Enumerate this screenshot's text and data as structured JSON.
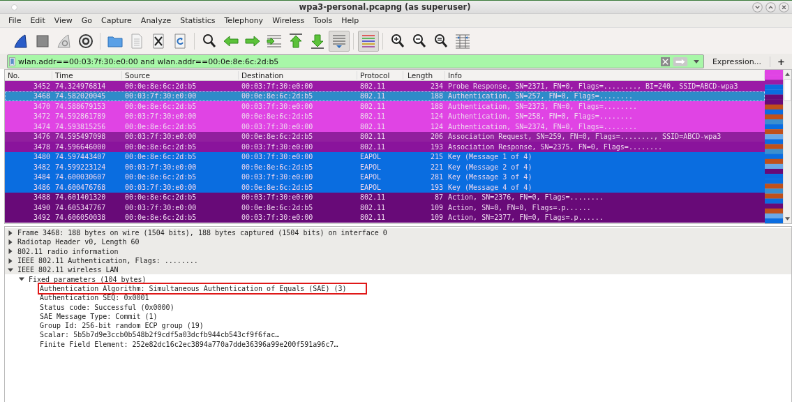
{
  "window": {
    "title": "wpa3-personal.pcapng (as superuser)"
  },
  "menu": [
    "File",
    "Edit",
    "View",
    "Go",
    "Capture",
    "Analyze",
    "Statistics",
    "Telephony",
    "Wireless",
    "Tools",
    "Help"
  ],
  "toolbar": [
    {
      "kind": "start",
      "pressed": false
    },
    {
      "kind": "stop",
      "pressed": false
    },
    {
      "kind": "restart",
      "pressed": false
    },
    {
      "kind": "options",
      "pressed": false
    },
    {
      "kind": "separator"
    },
    {
      "kind": "open",
      "pressed": false
    },
    {
      "kind": "save",
      "pressed": false
    },
    {
      "kind": "close",
      "pressed": false
    },
    {
      "kind": "reload",
      "pressed": false
    },
    {
      "kind": "separator"
    },
    {
      "kind": "find",
      "pressed": false
    },
    {
      "kind": "back",
      "pressed": false
    },
    {
      "kind": "forward",
      "pressed": false
    },
    {
      "kind": "goto",
      "pressed": false
    },
    {
      "kind": "first",
      "pressed": false
    },
    {
      "kind": "last",
      "pressed": false
    },
    {
      "kind": "autoscroll",
      "pressed": true
    },
    {
      "kind": "separator"
    },
    {
      "kind": "colorize",
      "pressed": true
    },
    {
      "kind": "separator"
    },
    {
      "kind": "zoomin",
      "pressed": false
    },
    {
      "kind": "zoomout",
      "pressed": false
    },
    {
      "kind": "zoomreset",
      "pressed": false
    },
    {
      "kind": "resize",
      "pressed": false
    }
  ],
  "filter": {
    "value": "wlan.addr==00:03:7f:30:e0:00 and wlan.addr==00:0e:8e:6c:2d:b5",
    "expression_button": "Expression...",
    "add_button": "+"
  },
  "table": {
    "columns": [
      "No.",
      "Time",
      "Source",
      "Destination",
      "Protocol",
      "Length",
      "Info"
    ],
    "rows": [
      {
        "no": "3452",
        "time": "74.324976814",
        "source": "00:0e:8e:6c:2d:b5",
        "destination": "00:03:7f:30:e0:00",
        "protocol": "802.11",
        "length": "234",
        "info": "Probe Response, SN=2371, FN=0, Flags=........, BI=240, SSID=ABCD-wpa3",
        "color": "#9a1aa6",
        "selected": false
      },
      {
        "no": "3468",
        "time": "74.582020045",
        "source": "00:03:7f:30:e0:00",
        "destination": "00:0e:8e:6c:2d:b5",
        "protocol": "802.11",
        "length": "188",
        "info": "Authentication, SN=257, FN=0, Flags=........",
        "color": "#2e8bc9",
        "selected": true
      },
      {
        "no": "3470",
        "time": "74.588679153",
        "source": "00:0e:8e:6c:2d:b5",
        "destination": "00:03:7f:30:e0:00",
        "protocol": "802.11",
        "length": "188",
        "info": "Authentication, SN=2373, FN=0, Flags=........",
        "color": "#e044e4",
        "selected": false
      },
      {
        "no": "3472",
        "time": "74.592861789",
        "source": "00:03:7f:30:e0:00",
        "destination": "00:0e:8e:6c:2d:b5",
        "protocol": "802.11",
        "length": "124",
        "info": "Authentication, SN=258, FN=0, Flags=........",
        "color": "#e044e4",
        "selected": false
      },
      {
        "no": "3474",
        "time": "74.593815256",
        "source": "00:0e:8e:6c:2d:b5",
        "destination": "00:03:7f:30:e0:00",
        "protocol": "802.11",
        "length": "124",
        "info": "Authentication, SN=2374, FN=0, Flags=........",
        "color": "#e044e4",
        "selected": false
      },
      {
        "no": "3476",
        "time": "74.595497098",
        "source": "00:03:7f:30:e0:00",
        "destination": "00:0e:8e:6c:2d:b5",
        "protocol": "802.11",
        "length": "206",
        "info": "Association Request, SN=259, FN=0, Flags=........, SSID=ABCD-wpa3",
        "color": "#911f9e",
        "selected": false
      },
      {
        "no": "3478",
        "time": "74.596646000",
        "source": "00:0e:8e:6c:2d:b5",
        "destination": "00:03:7f:30:e0:00",
        "protocol": "802.11",
        "length": "193",
        "info": "Association Response, SN=2375, FN=0, Flags=........",
        "color": "#8a149c",
        "selected": false
      },
      {
        "no": "3480",
        "time": "74.597443407",
        "source": "00:0e:8e:6c:2d:b5",
        "destination": "00:03:7f:30:e0:00",
        "protocol": "EAPOL",
        "length": "215",
        "info": "Key (Message 1 of 4)",
        "color": "#0a6de0",
        "selected": false
      },
      {
        "no": "3482",
        "time": "74.599223124",
        "source": "00:03:7f:30:e0:00",
        "destination": "00:0e:8e:6c:2d:b5",
        "protocol": "EAPOL",
        "length": "221",
        "info": "Key (Message 2 of 4)",
        "color": "#0a6de0",
        "selected": false
      },
      {
        "no": "3484",
        "time": "74.600030607",
        "source": "00:0e:8e:6c:2d:b5",
        "destination": "00:03:7f:30:e0:00",
        "protocol": "EAPOL",
        "length": "281",
        "info": "Key (Message 3 of 4)",
        "color": "#0a6de0",
        "selected": false
      },
      {
        "no": "3486",
        "time": "74.600476768",
        "source": "00:03:7f:30:e0:00",
        "destination": "00:0e:8e:6c:2d:b5",
        "protocol": "EAPOL",
        "length": "193",
        "info": "Key (Message 4 of 4)",
        "color": "#0a6de0",
        "selected": false
      },
      {
        "no": "3488",
        "time": "74.601401320",
        "source": "00:0e:8e:6c:2d:b5",
        "destination": "00:03:7f:30:e0:00",
        "protocol": "802.11",
        "length": "87",
        "info": "Action, SN=2376, FN=0, Flags=........",
        "color": "#680a78",
        "selected": false
      },
      {
        "no": "3490",
        "time": "74.605347767",
        "source": "00:03:7f:30:e0:00",
        "destination": "00:0e:8e:6c:2d:b5",
        "protocol": "802.11",
        "length": "109",
        "info": "Action, SN=0, FN=0, Flags=.p......",
        "color": "#680a78",
        "selected": false
      },
      {
        "no": "3492",
        "time": "74.606050038",
        "source": "00:0e:8e:6c:2d:b5",
        "destination": "00:03:7f:30:e0:00",
        "protocol": "802.11",
        "length": "109",
        "info": "Action, SN=2377, FN=0, Flags=.p......",
        "color": "#680a78",
        "selected": false
      }
    ]
  },
  "details": [
    {
      "text": "Frame 3468: 188 bytes on wire (1504 bits), 188 bytes captured (1504 bits) on interface 0",
      "expanded": false
    },
    {
      "text": "Radiotap Header v0, Length 60",
      "expanded": false
    },
    {
      "text": "802.11 radio information",
      "expanded": false
    },
    {
      "text": "IEEE 802.11 Authentication, Flags: ........",
      "expanded": false
    },
    {
      "text": "IEEE 802.11 wireless LAN",
      "expanded": true,
      "children": [
        {
          "text": "Fixed parameters (104 bytes)",
          "expanded": true,
          "children": [
            {
              "text": "Authentication Algorithm: Simultaneous Authentication of Equals (SAE) (3)",
              "highlighted": true
            },
            {
              "text": "Authentication SEQ: 0x0001",
              "highlighted": false
            },
            {
              "text": "Status code: Successful (0x0000)",
              "highlighted": false
            },
            {
              "text": "SAE Message Type: Commit (1)",
              "highlighted": false
            },
            {
              "text": "Group Id: 256-bit random ECP group (19)",
              "highlighted": false
            },
            {
              "text": "Scalar: 5b5b7d9e3ccb0b548b2f9cdf5a03dcfb944cb543cf9f6fac…",
              "highlighted": false
            },
            {
              "text": "Finite Field Element: 252e82dc16c2ec3894a770a7dde36396a99e200f591a96c7…",
              "highlighted": false
            }
          ]
        }
      ]
    }
  ]
}
